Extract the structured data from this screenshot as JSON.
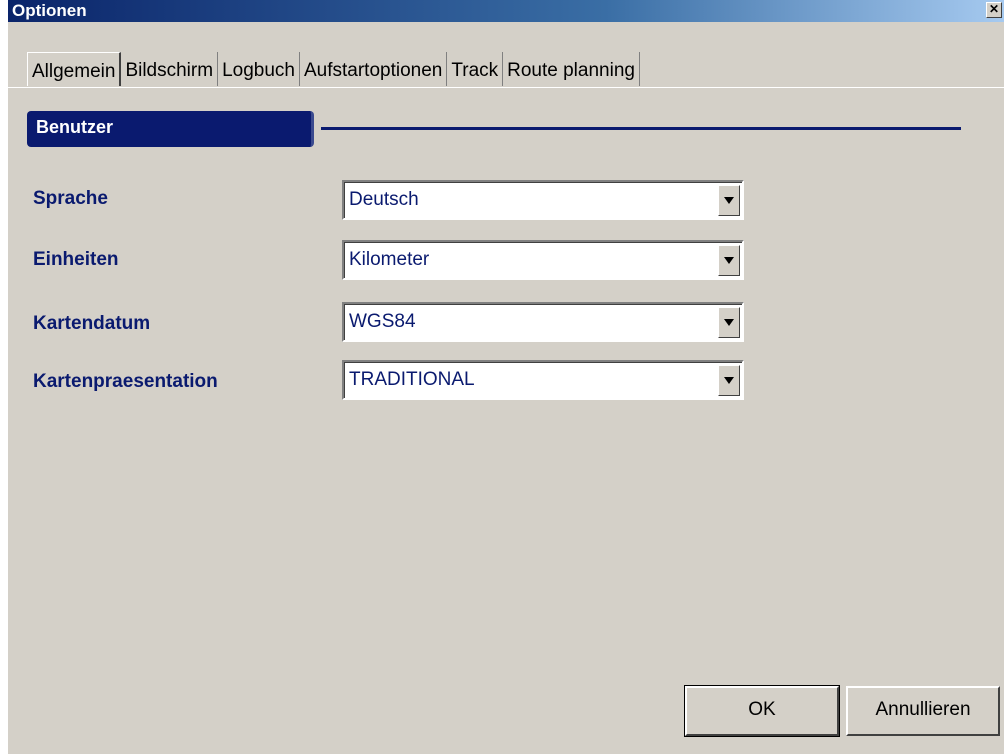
{
  "window": {
    "title": "Optionen",
    "close_glyph": "✕"
  },
  "tabs": [
    {
      "label": "Allgemein",
      "active": true
    },
    {
      "label": "Bildschirm",
      "active": false
    },
    {
      "label": "Logbuch",
      "active": false
    },
    {
      "label": "Aufstartoptionen",
      "active": false
    },
    {
      "label": "Track",
      "active": false
    },
    {
      "label": "Route planning",
      "active": false
    }
  ],
  "section": {
    "title": "Benutzer"
  },
  "fields": {
    "sprache": {
      "label": "Sprache",
      "value": "Deutsch"
    },
    "einheiten": {
      "label": "Einheiten",
      "value": "Kilometer"
    },
    "kartendatum": {
      "label": "Kartendatum",
      "value": "WGS84"
    },
    "kartenpraesentation": {
      "label": "Kartenpraesentation",
      "value": "TRADITIONAL"
    }
  },
  "buttons": {
    "ok": "OK",
    "cancel": "Annullieren"
  },
  "colors": {
    "accent": "#0a1a6f",
    "dialog_bg": "#d4d0c8"
  },
  "icons": {
    "close": "close-icon",
    "dropdown": "chevron-down-icon"
  }
}
